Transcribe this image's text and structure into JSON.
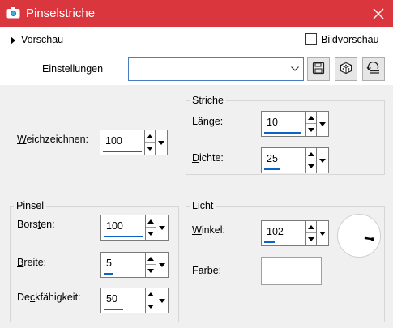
{
  "window": {
    "title": "Pinselstriche"
  },
  "header": {
    "preview_label": "Vorschau",
    "image_preview_label": "Bildvorschau",
    "image_preview_checked": false,
    "settings_label": "Einstellungen",
    "settings_value": ""
  },
  "soften": {
    "label": "Weichzeichnen:",
    "value": "100",
    "level": 1.0
  },
  "strokes": {
    "title": "Striche",
    "length": {
      "label": "Länge:",
      "value": "10",
      "level": 0.95
    },
    "density": {
      "label": "Dichte:",
      "value": "25",
      "level": 0.4
    }
  },
  "brush": {
    "title": "Pinsel",
    "bristles": {
      "label": "Borsten:",
      "value": "100",
      "level": 1.0
    },
    "width": {
      "label": "Breite:",
      "value": "5",
      "level": 0.25
    },
    "opacity": {
      "label": "Deckfähigkeit:",
      "value": "50",
      "level": 0.5
    }
  },
  "light": {
    "title": "Licht",
    "angle": {
      "label": "Winkel:",
      "value": "102",
      "level": 0.28
    },
    "color": {
      "label": "Farbe:",
      "value": "#ffffff"
    }
  },
  "icons": {
    "app": "camera-icon",
    "close": "close-icon",
    "save": "save-icon",
    "randomize": "dice-icon",
    "reset": "reset-icon"
  }
}
